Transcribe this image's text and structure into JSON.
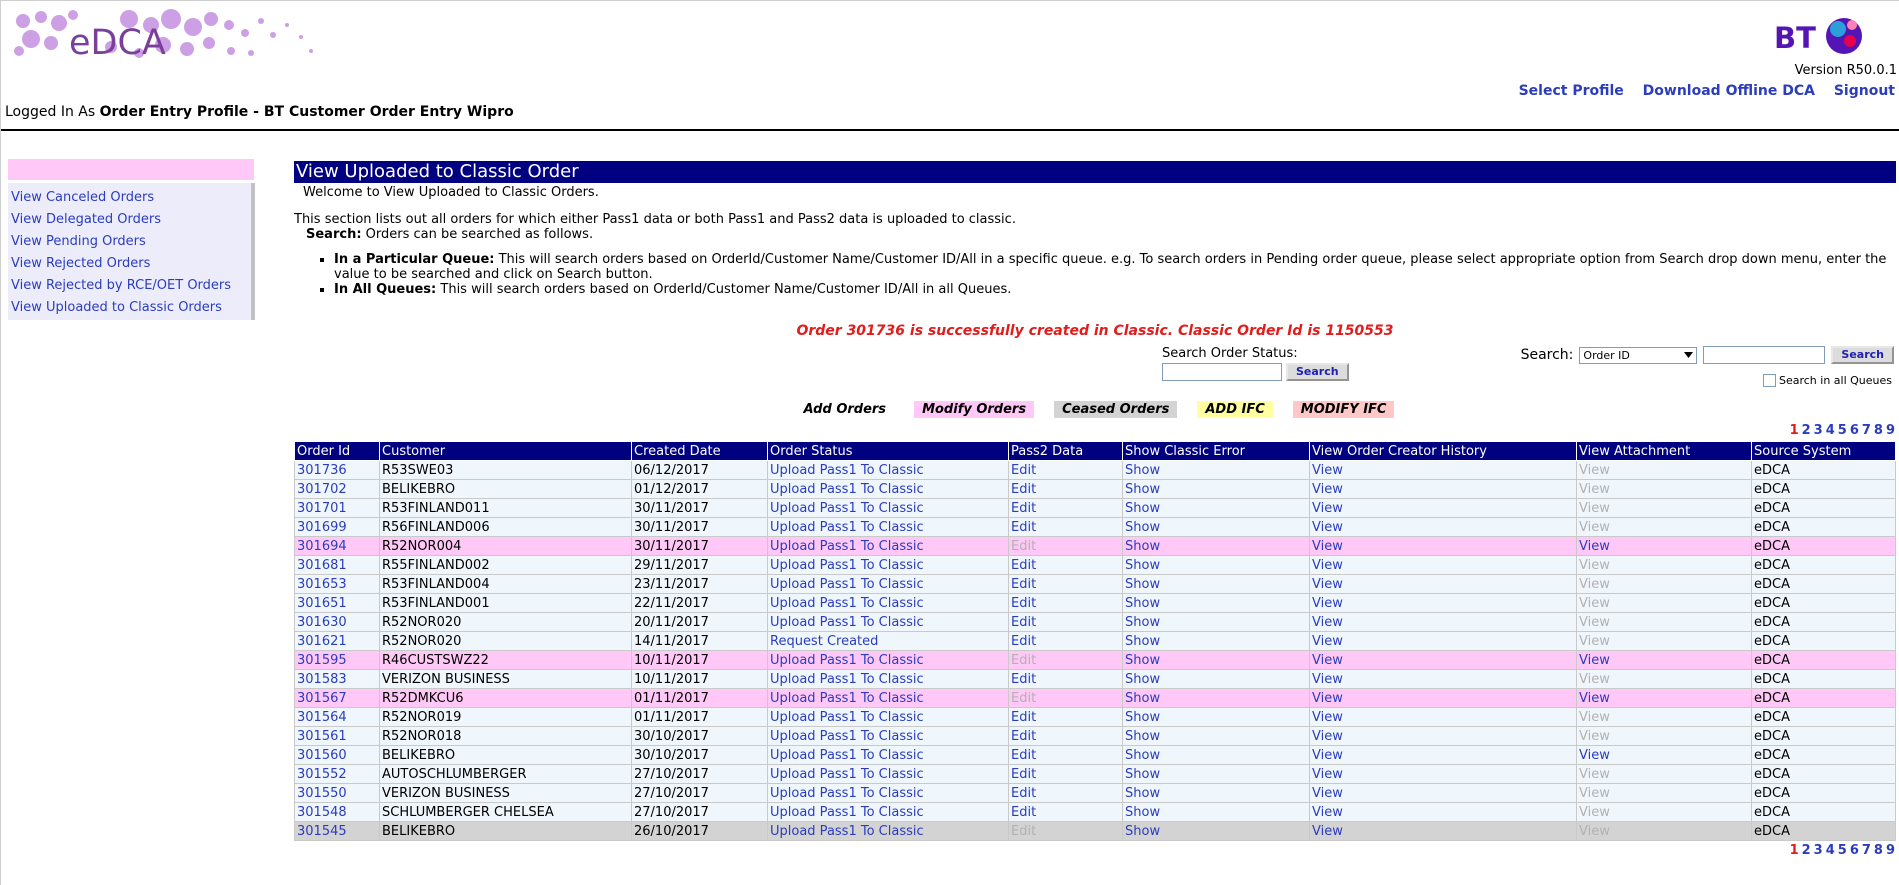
{
  "header": {
    "app_name": "eDCA",
    "brand": "BT",
    "version": "Version R50.0.1",
    "links": [
      "Select Profile",
      "Download Offline DCA",
      "Signout"
    ],
    "logged_in_prefix": "Logged In As",
    "logged_in_profile": "Order Entry Profile - BT Customer Order Entry Wipro"
  },
  "sidebar": {
    "items": [
      {
        "label": "View Canceled Orders"
      },
      {
        "label": "View Delegated Orders"
      },
      {
        "label": "View Pending Orders"
      },
      {
        "label": "View Rejected Orders"
      },
      {
        "label": "View Rejected by RCE/OET Orders"
      },
      {
        "label": "View Uploaded to Classic Orders"
      }
    ]
  },
  "main": {
    "title": "View Uploaded to Classic Order",
    "welcome": "Welcome to View Uploaded to Classic Orders.",
    "description": "This section lists out all orders for which either Pass1 data or both Pass1 and Pass2 data is uploaded to classic.",
    "search_label": "Search:",
    "search_desc": "Orders can be searched as follows.",
    "bullets": [
      {
        "term": "In a Particular Queue:",
        "text": "This will search orders based on OrderId/Customer Name/Customer ID/All in a specific queue. e.g. To search orders in Pending order queue, please select appropriate option from Search drop down menu, enter the value to be searched and click on Search button."
      },
      {
        "term": "In All Queues:",
        "text": "This will search orders based on OrderId/Customer Name/Customer ID/All in all Queues."
      }
    ],
    "success_message": "Order 301736 is successfully created in Classic. Classic Order Id is 1150553",
    "status_search": {
      "label": "Search Order Status:",
      "button": "Search",
      "value": ""
    },
    "search": {
      "label": "Search:",
      "selected": "Order ID",
      "value": "",
      "button": "Search",
      "all_queues_label": "Search in all Queues",
      "all_queues_checked": false
    },
    "legend": [
      {
        "label": "Add Orders",
        "color": "#ffffff"
      },
      {
        "label": "Modify Orders",
        "color": "#ffc8f6"
      },
      {
        "label": "Ceased Orders",
        "color": "#d3d3d3"
      },
      {
        "label": "ADD IFC",
        "color": "#ffffa0"
      },
      {
        "label": "MODIFY IFC",
        "color": "#ffc8c8"
      }
    ],
    "pages": [
      "1",
      "2",
      "3",
      "4",
      "5",
      "6",
      "7",
      "8",
      "9"
    ],
    "current_page": "1"
  },
  "table": {
    "columns": [
      "Order Id",
      "Customer",
      "Created Date",
      "Order Status",
      "Pass2 Data",
      "Show Classic Error",
      "View Order Creator History",
      "View Attachment",
      "Source System"
    ],
    "rows": [
      {
        "id": "301736",
        "customer": "R53SWE03",
        "date": "06/12/2017",
        "status": "Upload Pass1 To Classic",
        "pass2": "Edit",
        "error": "Show",
        "history": "View",
        "attachment": "View",
        "source": "eDCA",
        "type": "norm",
        "pass2_enabled": true,
        "attach_enabled": false
      },
      {
        "id": "301702",
        "customer": "BELIKEBRO",
        "date": "01/12/2017",
        "status": "Upload Pass1 To Classic",
        "pass2": "Edit",
        "error": "Show",
        "history": "View",
        "attachment": "View",
        "source": "eDCA",
        "type": "norm",
        "pass2_enabled": true,
        "attach_enabled": false
      },
      {
        "id": "301701",
        "customer": "R53FINLAND011",
        "date": "30/11/2017",
        "status": "Upload Pass1 To Classic",
        "pass2": "Edit",
        "error": "Show",
        "history": "View",
        "attachment": "View",
        "source": "eDCA",
        "type": "norm",
        "pass2_enabled": true,
        "attach_enabled": false
      },
      {
        "id": "301699",
        "customer": "R56FINLAND006",
        "date": "30/11/2017",
        "status": "Upload Pass1 To Classic",
        "pass2": "Edit",
        "error": "Show",
        "history": "View",
        "attachment": "View",
        "source": "eDCA",
        "type": "norm",
        "pass2_enabled": true,
        "attach_enabled": false
      },
      {
        "id": "301694",
        "customer": "R52NOR004",
        "date": "30/11/2017",
        "status": "Upload Pass1 To Classic",
        "pass2": "Edit",
        "error": "Show",
        "history": "View",
        "attachment": "View",
        "source": "eDCA",
        "type": "pink",
        "pass2_enabled": false,
        "attach_enabled": true
      },
      {
        "id": "301681",
        "customer": "R55FINLAND002",
        "date": "29/11/2017",
        "status": "Upload Pass1 To Classic",
        "pass2": "Edit",
        "error": "Show",
        "history": "View",
        "attachment": "View",
        "source": "eDCA",
        "type": "norm",
        "pass2_enabled": true,
        "attach_enabled": false
      },
      {
        "id": "301653",
        "customer": "R53FINLAND004",
        "date": "23/11/2017",
        "status": "Upload Pass1 To Classic",
        "pass2": "Edit",
        "error": "Show",
        "history": "View",
        "attachment": "View",
        "source": "eDCA",
        "type": "norm",
        "pass2_enabled": true,
        "attach_enabled": false
      },
      {
        "id": "301651",
        "customer": "R53FINLAND001",
        "date": "22/11/2017",
        "status": "Upload Pass1 To Classic",
        "pass2": "Edit",
        "error": "Show",
        "history": "View",
        "attachment": "View",
        "source": "eDCA",
        "type": "norm",
        "pass2_enabled": true,
        "attach_enabled": false
      },
      {
        "id": "301630",
        "customer": "R52NOR020",
        "date": "20/11/2017",
        "status": "Upload Pass1 To Classic",
        "pass2": "Edit",
        "error": "Show",
        "history": "View",
        "attachment": "View",
        "source": "eDCA",
        "type": "norm",
        "pass2_enabled": true,
        "attach_enabled": false
      },
      {
        "id": "301621",
        "customer": "R52NOR020",
        "date": "14/11/2017",
        "status": "Request Created",
        "pass2": "Edit",
        "error": "Show",
        "history": "View",
        "attachment": "View",
        "source": "eDCA",
        "type": "norm",
        "pass2_enabled": true,
        "attach_enabled": false
      },
      {
        "id": "301595",
        "customer": "R46CUSTSWZ22",
        "date": "10/11/2017",
        "status": "Upload Pass1 To Classic",
        "pass2": "Edit",
        "error": "Show",
        "history": "View",
        "attachment": "View",
        "source": "eDCA",
        "type": "pink",
        "pass2_enabled": false,
        "attach_enabled": true
      },
      {
        "id": "301583",
        "customer": "VERIZON BUSINESS",
        "date": "10/11/2017",
        "status": "Upload Pass1 To Classic",
        "pass2": "Edit",
        "error": "Show",
        "history": "View",
        "attachment": "View",
        "source": "eDCA",
        "type": "norm",
        "pass2_enabled": true,
        "attach_enabled": false
      },
      {
        "id": "301567",
        "customer": "R52DMKCU6",
        "date": "01/11/2017",
        "status": "Upload Pass1 To Classic",
        "pass2": "Edit",
        "error": "Show",
        "history": "View",
        "attachment": "View",
        "source": "eDCA",
        "type": "pink",
        "pass2_enabled": false,
        "attach_enabled": true
      },
      {
        "id": "301564",
        "customer": "R52NOR019",
        "date": "01/11/2017",
        "status": "Upload Pass1 To Classic",
        "pass2": "Edit",
        "error": "Show",
        "history": "View",
        "attachment": "View",
        "source": "eDCA",
        "type": "norm",
        "pass2_enabled": true,
        "attach_enabled": false
      },
      {
        "id": "301561",
        "customer": "R52NOR018",
        "date": "30/10/2017",
        "status": "Upload Pass1 To Classic",
        "pass2": "Edit",
        "error": "Show",
        "history": "View",
        "attachment": "View",
        "source": "eDCA",
        "type": "norm",
        "pass2_enabled": true,
        "attach_enabled": false
      },
      {
        "id": "301560",
        "customer": "BELIKEBRO",
        "date": "30/10/2017",
        "status": "Upload Pass1 To Classic",
        "pass2": "Edit",
        "error": "Show",
        "history": "View",
        "attachment": "View",
        "source": "eDCA",
        "type": "norm",
        "pass2_enabled": true,
        "attach_enabled": true
      },
      {
        "id": "301552",
        "customer": "AUTOSCHLUMBERGER",
        "date": "27/10/2017",
        "status": "Upload Pass1 To Classic",
        "pass2": "Edit",
        "error": "Show",
        "history": "View",
        "attachment": "View",
        "source": "eDCA",
        "type": "norm",
        "pass2_enabled": true,
        "attach_enabled": false
      },
      {
        "id": "301550",
        "customer": "VERIZON BUSINESS",
        "date": "27/10/2017",
        "status": "Upload Pass1 To Classic",
        "pass2": "Edit",
        "error": "Show",
        "history": "View",
        "attachment": "View",
        "source": "eDCA",
        "type": "norm",
        "pass2_enabled": true,
        "attach_enabled": false
      },
      {
        "id": "301548",
        "customer": "SCHLUMBERGER CHELSEA",
        "date": "27/10/2017",
        "status": "Upload Pass1 To Classic",
        "pass2": "Edit",
        "error": "Show",
        "history": "View",
        "attachment": "View",
        "source": "eDCA",
        "type": "norm",
        "pass2_enabled": true,
        "attach_enabled": false
      },
      {
        "id": "301545",
        "customer": "BELIKEBRO",
        "date": "26/10/2017",
        "status": "Upload Pass1 To Classic",
        "pass2": "Edit",
        "error": "Show",
        "history": "View",
        "attachment": "View",
        "source": "eDCA",
        "type": "gray",
        "pass2_enabled": false,
        "attach_enabled": false
      }
    ]
  }
}
